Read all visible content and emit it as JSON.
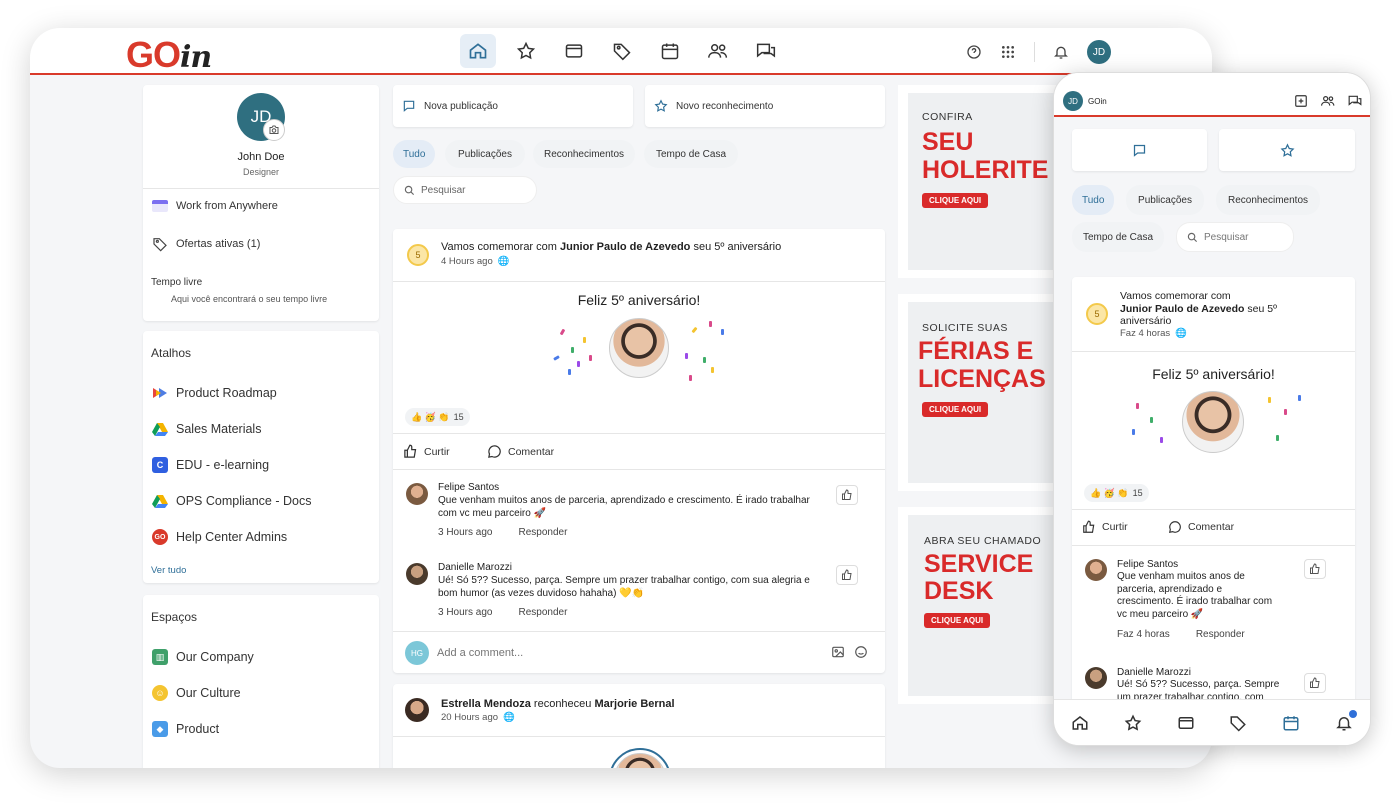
{
  "app": {
    "logo_text": "GO",
    "logo_suffix": "in",
    "brand_color": "#d93a2b",
    "accent_color": "#2f6f98"
  },
  "header": {
    "nav_icons": [
      "home-icon",
      "star-icon",
      "wallet-icon",
      "tag-icon",
      "calendar-icon",
      "people-icon",
      "chat-icon"
    ],
    "active": "home-icon",
    "user_initials": "JD"
  },
  "profile": {
    "initials": "JD",
    "name": "John Doe",
    "role": "Designer",
    "items": [
      {
        "icon": "calendar-strip-icon",
        "label": "Work from Anywhere"
      },
      {
        "icon": "tag-icon",
        "label": "Ofertas ativas (1)"
      }
    ],
    "free_time_title": "Tempo livre",
    "free_time_text": "Aqui você encontrará o seu tempo livre"
  },
  "shortcuts": {
    "title": "Atalhos",
    "items": [
      {
        "label": "Product Roadmap",
        "icon": "roadmap-icon"
      },
      {
        "label": "Sales Materials",
        "icon": "drive-icon"
      },
      {
        "label": "EDU - e-learning",
        "icon": "edu-icon"
      },
      {
        "label": "OPS Compliance - Docs",
        "icon": "drive-icon"
      },
      {
        "label": "Help Center Admins",
        "icon": "goin-icon"
      }
    ],
    "see_all": "Ver tudo"
  },
  "spaces": {
    "title": "Espaços",
    "items": [
      {
        "label": "Our Company"
      },
      {
        "label": "Our Culture"
      },
      {
        "label": "Product"
      }
    ]
  },
  "composer": {
    "new_post": "Nova publicação",
    "new_recognition": "Novo reconhecimento"
  },
  "filters": {
    "items": [
      "Tudo",
      "Publicações",
      "Reconhecimentos",
      "Tempo de Casa"
    ],
    "active": "Tudo",
    "search_placeholder": "Pesquisar"
  },
  "post1": {
    "text_pre": "Vamos comemorar com ",
    "person": "Junior Paulo de Azevedo",
    "text_post": " seu 5º aniversário",
    "time": "4 Hours ago",
    "badge": "5",
    "headline": "Feliz 5º aniversário!",
    "reaction_count": "15",
    "reaction_emojis": "👍 🥳 👏",
    "like": "Curtir",
    "comment": "Comentar",
    "comments": [
      {
        "name": "Felipe Santos",
        "text": "Que venham muitos anos de parceria, aprendizado e crescimento. É irado trabalhar com vc meu parceiro 🚀",
        "time": "3 Hours ago",
        "reply": "Responder"
      },
      {
        "name": "Danielle Marozzi",
        "text": "Ué! Só 5?? Sucesso, parça. Sempre um prazer trabalhar contigo, com sua alegria e bom humor (as vezes duvidoso hahaha) 💛👏",
        "time": "3 Hours ago",
        "reply": "Responder"
      }
    ],
    "comment_initials": "HG",
    "comment_placeholder": "Add a comment..."
  },
  "post2": {
    "actor": "Estrella Mendoza",
    "verb": " reconheceu ",
    "target": "Marjorie Bernal",
    "time": "20 Hours ago"
  },
  "banners": [
    {
      "small": "CONFIRA",
      "big1": "SEU",
      "big2": "HOLERITE",
      "button": "CLIQUE AQUI"
    },
    {
      "small": "SOLICITE SUAS",
      "big1": "FÉRIAS E",
      "big2": "LICENÇAS",
      "button": "CLIQUE AQUI"
    },
    {
      "small": "ABRA SEU CHAMADO",
      "big1": "SERVICE",
      "big2": "DESK",
      "button": "CLIQUE AQUI"
    }
  ],
  "mobile": {
    "initials": "JD",
    "app_name": "GOin",
    "filters": [
      "Tudo",
      "Publicações",
      "Reconhecimentos",
      "Tempo de Casa"
    ],
    "search_placeholder": "Pesquisar",
    "post_pre": "Vamos comemorar com",
    "post_person": "Junior Paulo de Azevedo",
    "post_mid": " seu 5º",
    "post_end": "aniversário",
    "time": "Faz 4 horas",
    "headline": "Feliz 5º aniversário!",
    "reaction_count": "15",
    "like": "Curtir",
    "comment": "Comentar",
    "c1_name": "Felipe Santos",
    "c1_l1": "Que venham muitos anos de",
    "c1_l2": "parceria, aprendizado e",
    "c1_l3": "crescimento. É irado trabalhar com",
    "c1_l4": "vc meu parceiro 🚀",
    "c1_time": "Faz 4 horas",
    "reply": "Responder",
    "c2_name": "Danielle Marozzi",
    "c2_l1": "Ué! Só 5?? Sucesso, parça. Sempre",
    "c2_l2": "um prazer trabalhar contigo, com"
  }
}
